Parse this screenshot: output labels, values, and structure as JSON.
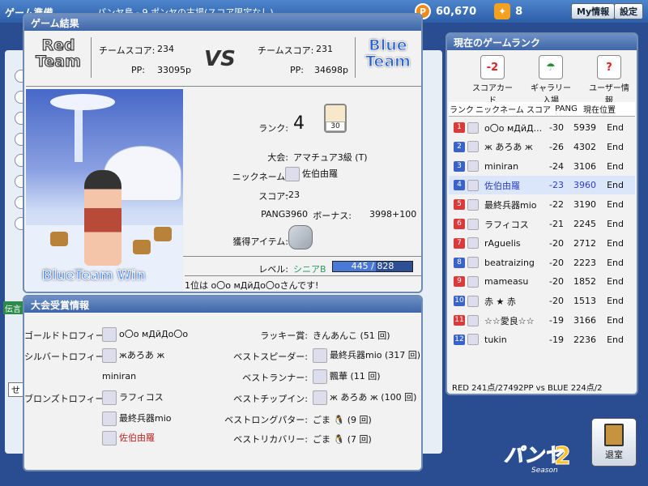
{
  "background": {
    "window_title": "ゲーム準備",
    "room_text": "パンヤ島 - 9 ポンヤの古場(スコア限定なし)",
    "pang": "60,670",
    "cookies": "8",
    "my_info_button": "My情報",
    "settings_button": "設定",
    "ticker": "伝言",
    "input_left": "せ"
  },
  "result": {
    "title": "ゲーム結果",
    "red_team": "Red Team",
    "blue_team": "Blue Team",
    "vs": "VS",
    "red_score_label": "チームスコア:",
    "red_score": "234",
    "red_pp_label": "PP:",
    "red_pp": "33095p",
    "blue_score_label": "チームスコア:",
    "blue_score": "231",
    "blue_pp_label": "PP:",
    "blue_pp": "34698p",
    "win_banner": "BlueTeam Win",
    "rank_label": "ランク:",
    "rank_value": "4",
    "trophy_label": "30",
    "tournament_label": "大会:",
    "tournament_value": "アマチュア3級 (T)",
    "nickname_label": "ニックネーム:",
    "nickname_value": "佐伯由羅",
    "score_label": "スコア:",
    "score_value": "-23",
    "pang_label": "PANG:",
    "pang_value": "3960",
    "bonus_label": "ボーナス:",
    "bonus_value": "3998+100",
    "item_label": "獲得アイテム:",
    "level_label": "レベル:",
    "level_name": "シニアB",
    "level_progress": "445 / 828",
    "level_fraction": 0.537,
    "footer": "1位は o〇o мДйДо〇oさんです!"
  },
  "award": {
    "title": "大会受賞情報",
    "gold_label": "ゴールドトロフィー:",
    "gold_name": "o〇o мДйДо〇o",
    "silver_label": "シルバートロフィー:",
    "silver_name": "жあろあ ж",
    "silver_name2": "miniran",
    "bronze_label": "ブロンズトロフィー:",
    "bronze_name1": "ラフィコス",
    "bronze_name2": "最終兵器mio",
    "bronze_name3": "佐伯由羅",
    "lucky_label": "ラッキー賞:",
    "lucky_value": "きんあんこ (51 回)",
    "speeder_label": "ベストスピーダー:",
    "speeder_value": "最終兵器mio (317 回)",
    "runner_label": "ベストランナー:",
    "runner_value": "飄華 (11 回)",
    "chipin_label": "ベストチップイン:",
    "chipin_value": "ж あろあ ж (100 回)",
    "longputter_label": "ベストロングパター:",
    "longputter_value": "ごま",
    "longputter_count": "(9 回)",
    "recovery_label": "ベストリカバリー:",
    "recovery_value": "ごま",
    "recovery_count": "(7 回)"
  },
  "rank": {
    "title": "現在のゲームランク",
    "icons": [
      {
        "label": "スコアカード",
        "glyph": "-2"
      },
      {
        "label": "ギャラリー入場",
        "glyph": "☂"
      },
      {
        "label": "ユーザー情報",
        "glyph": "?"
      }
    ],
    "headers": [
      "ランク",
      "ニックネーム",
      "スコア",
      "PANG",
      "現在位置"
    ],
    "rows": [
      {
        "rank": "1",
        "name": "o〇o мДйД...",
        "score": "-30",
        "pang": "5939",
        "pos": "End",
        "team": "red",
        "color": "#111"
      },
      {
        "rank": "2",
        "name": "ж あろあ ж",
        "score": "-26",
        "pang": "4302",
        "pos": "End",
        "team": "blue",
        "color": "#111"
      },
      {
        "rank": "3",
        "name": "miniran",
        "score": "-24",
        "pang": "3106",
        "pos": "End",
        "team": "blue",
        "color": "#111"
      },
      {
        "rank": "4",
        "name": "佐伯由羅",
        "score": "-23",
        "pang": "3960",
        "pos": "End",
        "team": "blue",
        "color": "#2a3ec9"
      },
      {
        "rank": "5",
        "name": "最終兵器mio",
        "score": "-22",
        "pang": "3190",
        "pos": "End",
        "team": "red",
        "color": "#111"
      },
      {
        "rank": "6",
        "name": "ラフィコス",
        "score": "-21",
        "pang": "2245",
        "pos": "End",
        "team": "red",
        "color": "#111"
      },
      {
        "rank": "7",
        "name": "rAguelis",
        "score": "-20",
        "pang": "2712",
        "pos": "End",
        "team": "red",
        "color": "#111"
      },
      {
        "rank": "8",
        "name": "beatraizing",
        "score": "-20",
        "pang": "2223",
        "pos": "End",
        "team": "blue",
        "color": "#111"
      },
      {
        "rank": "9",
        "name": "mameasu",
        "score": "-20",
        "pang": "1852",
        "pos": "End",
        "team": "red",
        "color": "#111"
      },
      {
        "rank": "10",
        "name": "赤 ★ 赤",
        "score": "-20",
        "pang": "1513",
        "pos": "End",
        "team": "blue",
        "color": "#111"
      },
      {
        "rank": "11",
        "name": "☆☆愛良☆☆",
        "score": "-19",
        "pang": "3166",
        "pos": "End",
        "team": "red",
        "color": "#111"
      },
      {
        "rank": "12",
        "name": "tukin",
        "score": "-19",
        "pang": "2236",
        "pos": "End",
        "team": "blue",
        "color": "#111"
      }
    ],
    "footer": "RED 241点/27492PP  vs  BLUE 224点/2"
  },
  "exit_button": "退室",
  "logo": {
    "main": "パンヤ",
    "number": "2",
    "sub": "Season"
  },
  "colors": {
    "red_badge": "#d93a3a",
    "blue_badge": "#3a63c9",
    "panel_header": "#4a70ae"
  }
}
